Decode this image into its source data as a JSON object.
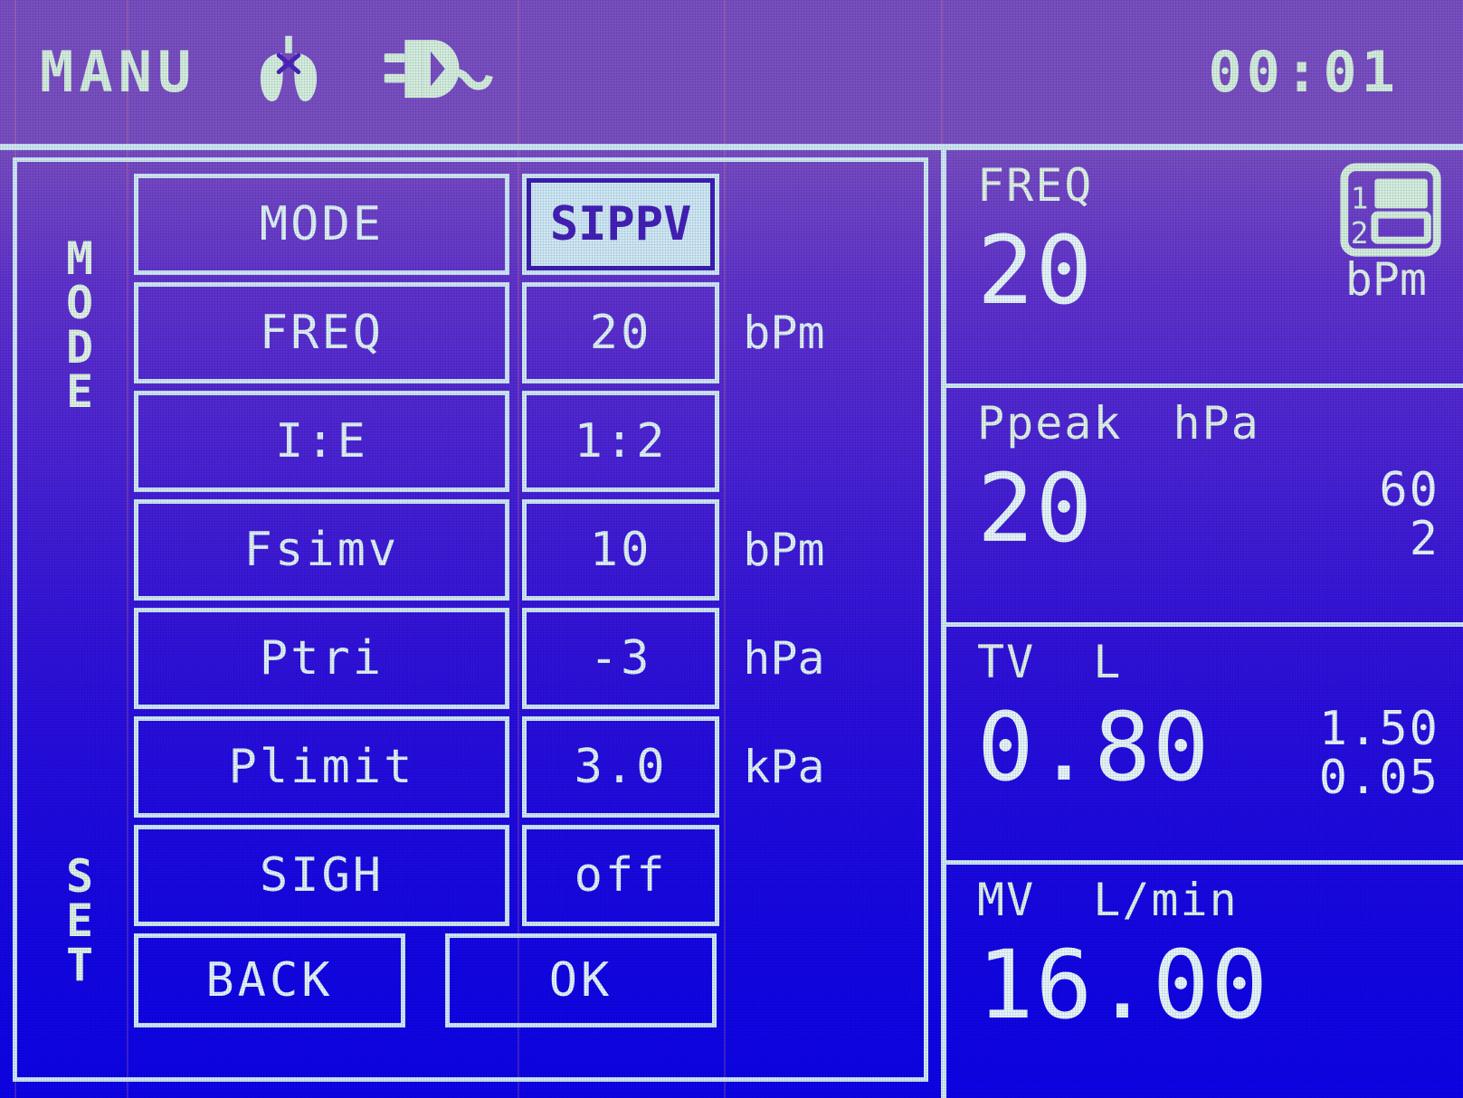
{
  "statusbar": {
    "mode_label": "MANU",
    "lungs_icon": "lungs-icon",
    "plug_icon": "power-plug-icon",
    "clock": "00:01"
  },
  "left_panel": {
    "rail": {
      "mode_letters": [
        "M",
        "O",
        "D",
        "E"
      ],
      "set_letters": [
        "S",
        "E",
        "T"
      ]
    },
    "rows": [
      {
        "label": "MODE",
        "value": "SIPPV",
        "unit": "",
        "selected": true
      },
      {
        "label": "FREQ",
        "value": "20",
        "unit": "bPm",
        "selected": false
      },
      {
        "label": "I:E",
        "value": "1:2",
        "unit": "",
        "selected": false
      },
      {
        "label": "Fsimv",
        "value": "10",
        "unit": "bPm",
        "selected": false
      },
      {
        "label": "Ptri",
        "value": "-3",
        "unit": "hPa",
        "selected": false
      },
      {
        "label": "Plimit",
        "value": "3.0",
        "unit": "kPa",
        "selected": false
      },
      {
        "label": "SIGH",
        "value": "off",
        "unit": "",
        "selected": false
      }
    ],
    "buttons": {
      "back": "BACK",
      "ok": "OK"
    }
  },
  "right_panel": {
    "page_indicator": {
      "icon": "page-select-icon",
      "page_one": "1",
      "page_two": "2",
      "active_page": 1
    },
    "blocks": [
      {
        "name": "FREQ",
        "title": "FREQ",
        "unit_head": "",
        "value": "20",
        "inline_unit": "bPm",
        "limit_high": "",
        "limit_low": ""
      },
      {
        "name": "Ppeak",
        "title": "Ppeak",
        "unit_head": "hPa",
        "value": "20",
        "inline_unit": "",
        "limit_high": "60",
        "limit_low": "2"
      },
      {
        "name": "TV",
        "title": "TV",
        "unit_head": "L",
        "value": "0.80",
        "inline_unit": "",
        "limit_high": "1.50",
        "limit_low": "0.05"
      },
      {
        "name": "MV",
        "title": "MV",
        "unit_head": "L/min",
        "value": "16.00",
        "inline_unit": "",
        "limit_high": "",
        "limit_low": ""
      }
    ]
  },
  "colors": {
    "lcd_foreground": "#d9f2fb",
    "lcd_foreground_green": "#d4efe0",
    "background_top": "#7a4fc4",
    "background_bottom": "#0d04ea",
    "selected_fill": "#cfe9f7",
    "selected_text": "#4421b8"
  }
}
